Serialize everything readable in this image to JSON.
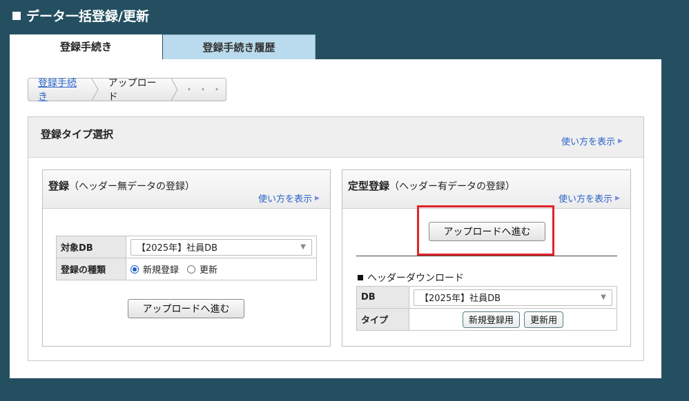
{
  "page": {
    "title": "データ一括登録/更新"
  },
  "tabs": [
    {
      "label": "登録手続き",
      "active": true
    },
    {
      "label": "登録手続き履歴",
      "active": false
    }
  ],
  "breadcrumb": {
    "step1": "登録手続き",
    "step2": "アップロード",
    "step3": "・・・"
  },
  "type_section": {
    "title": "登録タイプ選択",
    "howto": "使い方を表示"
  },
  "left_panel": {
    "title_bold": "登録",
    "title_note": "（ヘッダー無データの登録）",
    "howto": "使い方を表示",
    "db_label": "対象DB",
    "db_value": "【2025年】社員DB",
    "kind_label": "登録の種類",
    "radio_new": "新規登録",
    "radio_update": "更新",
    "selected": "新規登録",
    "button": "アップロードへ進む"
  },
  "right_panel": {
    "title_bold": "定型登録",
    "title_note": "（ヘッダー有データの登録）",
    "howto": "使い方を表示",
    "button": "アップロードへ進む",
    "download_title": "ヘッダーダウンロード",
    "db_label": "DB",
    "db_value": "【2025年】社員DB",
    "type_label": "タイプ",
    "btn_new": "新規登録用",
    "btn_update": "更新用"
  },
  "colors": {
    "background": "#244f60",
    "tab_inactive": "#b9dbed",
    "link": "#2a64c8",
    "highlight": "#e0232a"
  }
}
